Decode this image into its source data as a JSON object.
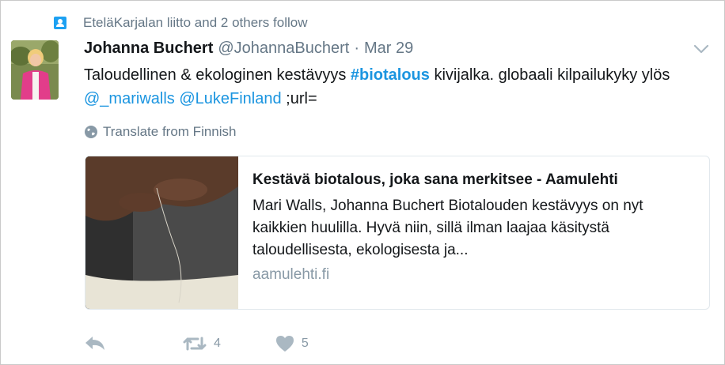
{
  "context": {
    "follow_text": "EteläKarjalan liitto and 2 others follow",
    "icon": "follow-person-icon"
  },
  "tweet": {
    "author_name": "Johanna Buchert",
    "author_handle": "@JohannaBuchert",
    "separator": "·",
    "date": "Mar 29",
    "text_part1": "Taloudellinen & ekologinen kestävyys ",
    "hashtag": "#biotalous",
    "text_part2": " kivijalka. globaali kilpailukyky ylös ",
    "mention1": "@_mariwalls",
    "text_space": " ",
    "mention2": "@LukeFinland",
    "text_part3": " ;url=",
    "translate_label": "Translate from Finnish"
  },
  "card": {
    "title": "Kestävä biotalous, joka sana merkitsee - Aamulehti",
    "description": "Mari Walls, Johanna Buchert Biotalouden kestävyys on nyt kaikkien huulilla. Hyvä niin, sillä ilman laajaa käsitystä taloudellisesta, ekologisesta ja...",
    "domain": "aamulehti.fi"
  },
  "actions": {
    "reply_icon": "reply-icon",
    "retweet_icon": "retweet-icon",
    "retweet_count": "4",
    "like_icon": "heart-icon",
    "like_count": "5"
  },
  "colors": {
    "link": "#1b95e0",
    "secondary_text": "#657786",
    "action_gray": "#8899a6",
    "follow_icon": "#1da1f2"
  }
}
